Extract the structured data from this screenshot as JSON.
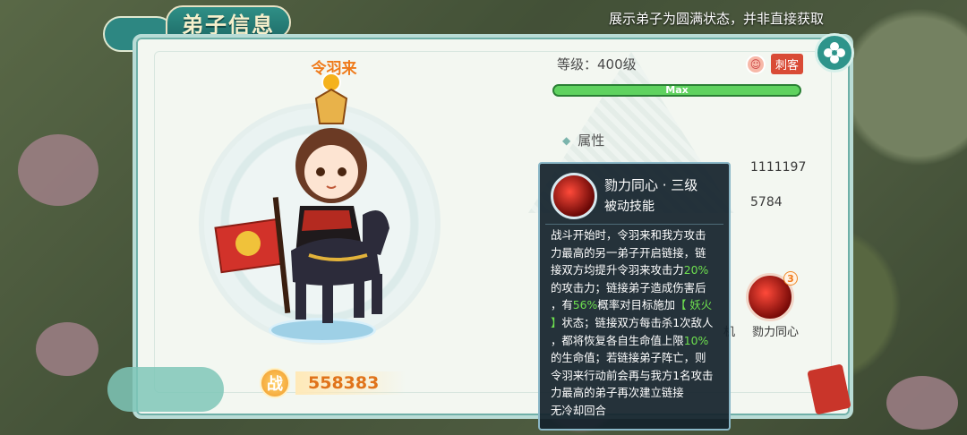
{
  "header": {
    "title": "弟子信息",
    "note": "展示弟子为圆满状态，并非直接获取"
  },
  "character": {
    "name": "令羽来",
    "power_icon_text": "战",
    "power": "558383"
  },
  "info": {
    "level_label": "等级：400级",
    "role_badge": "刺客",
    "exp_text": "Max",
    "exp_fraction": 1.0,
    "attr_title": "属性",
    "stat_1": "1111197",
    "stat_2": "5784"
  },
  "skill": {
    "name": "勠力同心",
    "level_badge": "3",
    "prev_label_fragment": "机"
  },
  "tooltip": {
    "name": "勠力同心 · 三级",
    "type": "被动技能",
    "desc_lines": [
      "战斗开始时，令羽来和我方攻击",
      "力最高的另一弟子开启链接，链",
      "接双方均提升令羽来攻击力",
      "的攻击力；链接弟子造成伤害后",
      "，有",
      "】状态；链接双方每击杀1次敌人",
      "，都将恢复各自生命值上限",
      "的生命值；若链接弟子阵亡，则",
      "令羽来行动前会再与我方1名攻击",
      "力最高的弟子再次建立链接",
      "无冷却回合"
    ],
    "hl_attack": "20%",
    "hl_chance": "56%",
    "mid_text": "概率对目标施加",
    "hl_effect": "【 妖火",
    "hl_heal": "10%"
  },
  "colors": {
    "accent_teal": "#2e948b",
    "name_orange": "#ef7a1a",
    "highlight_green": "#6ee04f",
    "role_red": "#d94b36",
    "exp_green": "#3fae4a"
  }
}
